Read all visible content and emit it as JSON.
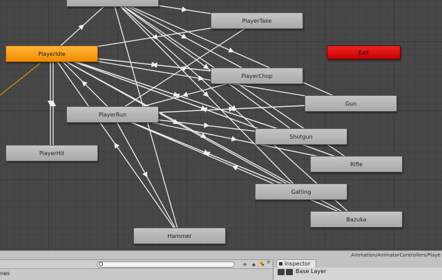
{
  "graph": {
    "states": [
      {
        "id": "top",
        "label": "",
        "type": "normal"
      },
      {
        "id": "take",
        "label": "PlayerTake",
        "type": "normal"
      },
      {
        "id": "idle",
        "label": "PlayerIdle",
        "type": "default"
      },
      {
        "id": "exit",
        "label": "Exit",
        "type": "exit"
      },
      {
        "id": "chop",
        "label": "PlayerChop",
        "type": "normal"
      },
      {
        "id": "gun",
        "label": "Gun",
        "type": "normal"
      },
      {
        "id": "run",
        "label": "PlayerRun",
        "type": "normal"
      },
      {
        "id": "shotgun",
        "label": "Shotgun",
        "type": "normal"
      },
      {
        "id": "hit",
        "label": "PlayerHit",
        "type": "normal"
      },
      {
        "id": "rifle",
        "label": "Rifle",
        "type": "normal"
      },
      {
        "id": "gatling",
        "label": "Gatling",
        "type": "normal"
      },
      {
        "id": "bazuka",
        "label": "Bazuka",
        "type": "normal"
      },
      {
        "id": "hammer",
        "label": "Hammer",
        "type": "normal"
      }
    ],
    "colors": {
      "default_state": "#f29000",
      "exit_state": "#e01010",
      "normal_state": "#b4b4b4",
      "edge": "#f0f0f0",
      "entry_edge": "#d08a00"
    }
  },
  "path_bar": {
    "text": "Animation/AnimatorControllers/Playe"
  },
  "bottom_panel": {
    "label": "nes",
    "search_placeholder": "",
    "lock_glyph": "🔒",
    "menu_glyph": "≡"
  },
  "inspector": {
    "tab_label": "Inspector",
    "layer_name": "Base Layer"
  }
}
